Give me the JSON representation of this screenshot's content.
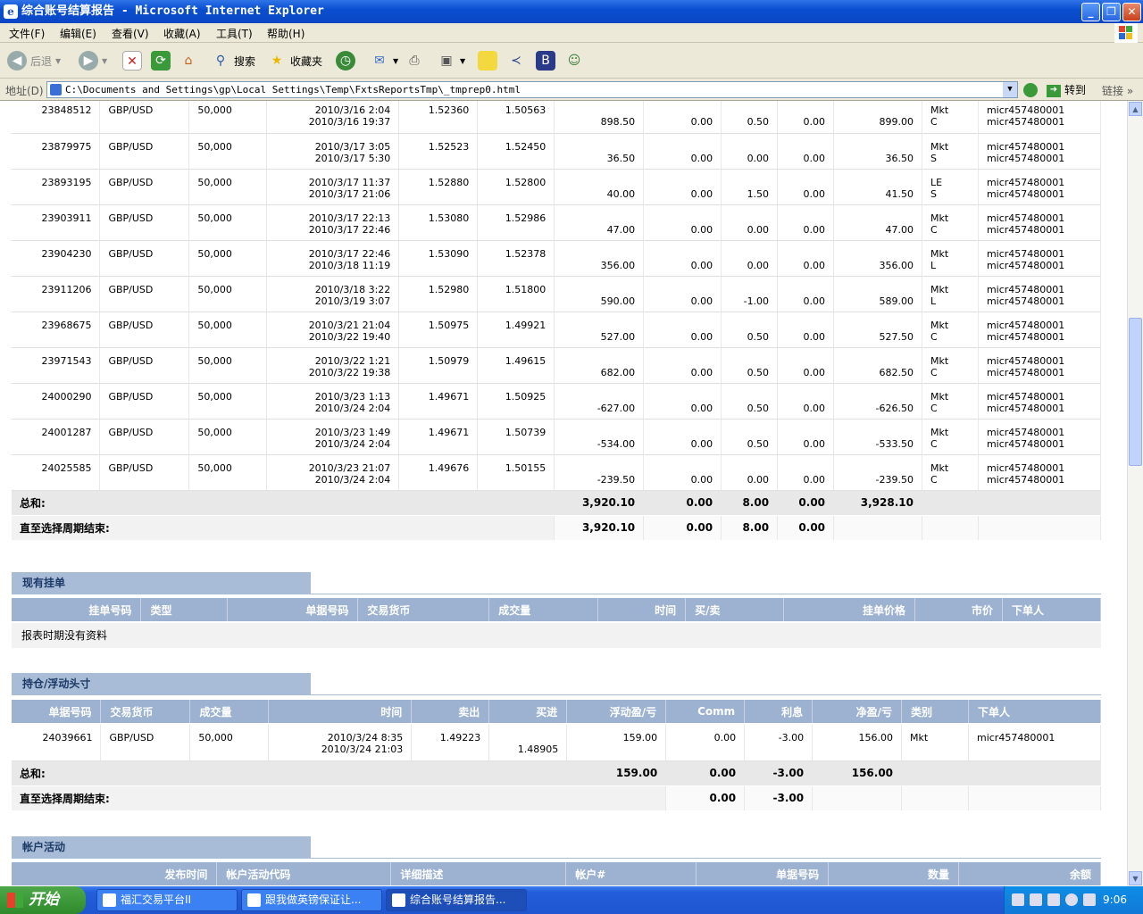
{
  "window": {
    "title": "综合账号结算报告 - Microsoft Internet Explorer",
    "buttons": [
      "_",
      "❐",
      "✕"
    ]
  },
  "menu": [
    "文件(F)",
    "编辑(E)",
    "查看(V)",
    "收藏(A)",
    "工具(T)",
    "帮助(H)"
  ],
  "toolbar": {
    "back": "后退",
    "search": "搜索",
    "favorites": "收藏夹"
  },
  "address": {
    "label": "地址(D)",
    "url": "C:\\Documents and Settings\\gp\\Local Settings\\Temp\\FxtsReportsTmp\\_tmprep0.html",
    "go": "转到",
    "links": "链接"
  },
  "closed_trades": {
    "rows": [
      {
        "id": "23848512",
        "pair": "GBP/USD",
        "amount": "50,000",
        "open_time": "2010/3/16 2:04",
        "close_time": "2010/3/16 19:37",
        "sell": "",
        "sell2": "1.52360",
        "buy": "1.50563",
        "buy2": "",
        "pl": "898.50",
        "comm": "0.00",
        "interest": "0.50",
        "adj": "0.00",
        "net": "899.00",
        "type": "Mkt",
        "type2": "C",
        "by": "micr457480001",
        "by2": "micr457480001"
      },
      {
        "id": "23879975",
        "pair": "GBP/USD",
        "amount": "50,000",
        "open_time": "2010/3/17 3:05",
        "close_time": "2010/3/17 5:30",
        "sell": "1.52523",
        "sell2": "",
        "buy": "",
        "buy2": "1.52450",
        "pl": "36.50",
        "comm": "0.00",
        "interest": "0.00",
        "adj": "0.00",
        "net": "36.50",
        "type": "Mkt",
        "type2": "S",
        "by": "micr457480001",
        "by2": "micr457480001"
      },
      {
        "id": "23893195",
        "pair": "GBP/USD",
        "amount": "50,000",
        "open_time": "2010/3/17 11:37",
        "close_time": "2010/3/17 21:06",
        "sell": "",
        "sell2": "1.52880",
        "buy": "1.52800",
        "buy2": "",
        "pl": "40.00",
        "comm": "0.00",
        "interest": "1.50",
        "adj": "0.00",
        "net": "41.50",
        "type": "LE",
        "type2": "S",
        "by": "micr457480001",
        "by2": "micr457480001"
      },
      {
        "id": "23903911",
        "pair": "GBP/USD",
        "amount": "50,000",
        "open_time": "2010/3/17 22:13",
        "close_time": "2010/3/17 22:46",
        "sell": "",
        "sell2": "1.53080",
        "buy": "1.52986",
        "buy2": "",
        "pl": "47.00",
        "comm": "0.00",
        "interest": "0.00",
        "adj": "0.00",
        "net": "47.00",
        "type": "Mkt",
        "type2": "C",
        "by": "micr457480001",
        "by2": "micr457480001"
      },
      {
        "id": "23904230",
        "pair": "GBP/USD",
        "amount": "50,000",
        "open_time": "2010/3/17 22:46",
        "close_time": "2010/3/18 11:19",
        "sell": "1.53090",
        "sell2": "",
        "buy": "",
        "buy2": "1.52378",
        "pl": "356.00",
        "comm": "0.00",
        "interest": "0.00",
        "adj": "0.00",
        "net": "356.00",
        "type": "Mkt",
        "type2": "L",
        "by": "micr457480001",
        "by2": "micr457480001"
      },
      {
        "id": "23911206",
        "pair": "GBP/USD",
        "amount": "50,000",
        "open_time": "2010/3/18 3:22",
        "close_time": "2010/3/19 3:07",
        "sell": "1.52980",
        "sell2": "",
        "buy": "",
        "buy2": "1.51800",
        "pl": "590.00",
        "comm": "0.00",
        "interest": "-1.00",
        "adj": "0.00",
        "net": "589.00",
        "type": "Mkt",
        "type2": "L",
        "by": "micr457480001",
        "by2": "micr457480001"
      },
      {
        "id": "23968675",
        "pair": "GBP/USD",
        "amount": "50,000",
        "open_time": "2010/3/21 21:04",
        "close_time": "2010/3/22 19:40",
        "sell": "",
        "sell2": "1.50975",
        "buy": "1.49921",
        "buy2": "",
        "pl": "527.00",
        "comm": "0.00",
        "interest": "0.50",
        "adj": "0.00",
        "net": "527.50",
        "type": "Mkt",
        "type2": "C",
        "by": "micr457480001",
        "by2": "micr457480001"
      },
      {
        "id": "23971543",
        "pair": "GBP/USD",
        "amount": "50,000",
        "open_time": "2010/3/22 1:21",
        "close_time": "2010/3/22 19:38",
        "sell": "",
        "sell2": "1.50979",
        "buy": "1.49615",
        "buy2": "",
        "pl": "682.00",
        "comm": "0.00",
        "interest": "0.50",
        "adj": "0.00",
        "net": "682.50",
        "type": "Mkt",
        "type2": "C",
        "by": "micr457480001",
        "by2": "micr457480001"
      },
      {
        "id": "24000290",
        "pair": "GBP/USD",
        "amount": "50,000",
        "open_time": "2010/3/23 1:13",
        "close_time": "2010/3/24 2:04",
        "sell": "",
        "sell2": "1.49671",
        "buy": "1.50925",
        "buy2": "",
        "pl": "-627.00",
        "comm": "0.00",
        "interest": "0.50",
        "adj": "0.00",
        "net": "-626.50",
        "type": "Mkt",
        "type2": "C",
        "by": "micr457480001",
        "by2": "micr457480001"
      },
      {
        "id": "24001287",
        "pair": "GBP/USD",
        "amount": "50,000",
        "open_time": "2010/3/23 1:49",
        "close_time": "2010/3/24 2:04",
        "sell": "",
        "sell2": "1.49671",
        "buy": "1.50739",
        "buy2": "",
        "pl": "-534.00",
        "comm": "0.00",
        "interest": "0.50",
        "adj": "0.00",
        "net": "-533.50",
        "type": "Mkt",
        "type2": "C",
        "by": "micr457480001",
        "by2": "micr457480001"
      },
      {
        "id": "24025585",
        "pair": "GBP/USD",
        "amount": "50,000",
        "open_time": "2010/3/23 21:07",
        "close_time": "2010/3/24 2:04",
        "sell": "",
        "sell2": "1.49676",
        "buy": "1.50155",
        "buy2": "",
        "pl": "-239.50",
        "comm": "0.00",
        "interest": "0.00",
        "adj": "0.00",
        "net": "-239.50",
        "type": "Mkt",
        "type2": "C",
        "by": "micr457480001",
        "by2": "micr457480001"
      }
    ],
    "total_label": "总和:",
    "total": {
      "pl": "3,920.10",
      "comm": "0.00",
      "interest": "8.00",
      "adj": "0.00",
      "net": "3,928.10"
    },
    "period_label": "直至选择周期结束:",
    "period": {
      "pl": "3,920.10",
      "comm": "0.00",
      "interest": "8.00",
      "adj": "0.00"
    }
  },
  "pending_orders": {
    "title": "现有挂单",
    "headers": [
      "挂单号码",
      "类型",
      "单据号码",
      "交易货币",
      "成交量",
      "时间",
      "买/卖",
      "挂单价格",
      "市价",
      "下单人"
    ],
    "empty": "报表时期没有资料"
  },
  "open_positions": {
    "title": "持仓/浮动头寸",
    "headers": [
      "单据号码",
      "交易货币",
      "成交量",
      "时间",
      "卖出",
      "买进",
      "浮动盈/亏",
      "Comm",
      "利息",
      "净盈/亏",
      "类别",
      "下单人"
    ],
    "row": {
      "id": "24039661",
      "pair": "GBP/USD",
      "amount": "50,000",
      "open_time": "2010/3/24 8:35",
      "close_time": "2010/3/24 21:03",
      "sell": "1.49223",
      "buy": "1.48905",
      "pl": "159.00",
      "comm": "0.00",
      "interest": "-3.00",
      "net": "156.00",
      "type": "Mkt",
      "by": "micr457480001"
    },
    "total_label": "总和:",
    "total": {
      "pl": "159.00",
      "comm": "0.00",
      "interest": "-3.00",
      "net": "156.00"
    },
    "period_label": "直至选择周期结束:",
    "period": {
      "comm": "0.00",
      "interest": "-3.00"
    }
  },
  "account_activity": {
    "title": "帐户活动",
    "headers": [
      "发布时间",
      "帐户活动代码",
      "详细描述",
      "帐户#",
      "单据号码",
      "数量",
      "余额"
    ]
  },
  "taskbar": {
    "start": "开始",
    "tasks": [
      "福汇交易平台II",
      "跟我做英镑保证让...",
      "综合账号结算报告..."
    ],
    "clock": "9:06"
  }
}
